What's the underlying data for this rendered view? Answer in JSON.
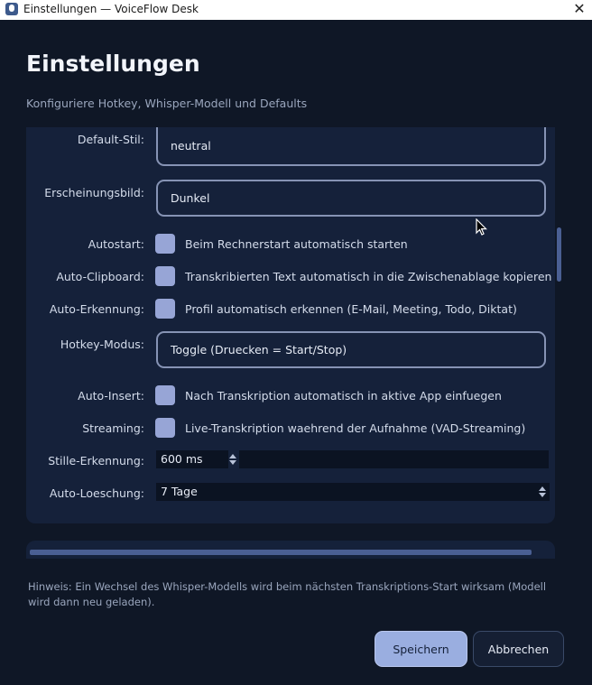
{
  "window": {
    "title": "Einstellungen — VoiceFlow Desk"
  },
  "page": {
    "title": "Einstellungen",
    "subtitle": "Konfiguriere Hotkey, Whisper-Modell und Defaults"
  },
  "settings": {
    "default_stil": {
      "label": "Default-Stil:",
      "value": "neutral"
    },
    "erscheinungsbild": {
      "label": "Erscheinungsbild:",
      "value": "Dunkel"
    },
    "autostart": {
      "label": "Autostart:",
      "text": "Beim Rechnerstart automatisch starten"
    },
    "auto_clipboard": {
      "label": "Auto-Clipboard:",
      "text": "Transkribierten Text automatisch in die Zwischenablage kopieren"
    },
    "auto_erkennung": {
      "label": "Auto-Erkennung:",
      "text": "Profil automatisch erkennen (E-Mail, Meeting, Todo, Diktat)"
    },
    "hotkey_modus": {
      "label": "Hotkey-Modus:",
      "value": "Toggle (Druecken = Start/Stop)"
    },
    "auto_insert": {
      "label": "Auto-Insert:",
      "text": "Nach Transkription automatisch in aktive App einfuegen"
    },
    "streaming": {
      "label": "Streaming:",
      "text": "Live-Transkription waehrend der Aufnahme (VAD-Streaming)"
    },
    "stille_erkennung": {
      "label": "Stille-Erkennung:",
      "value": "600 ms"
    },
    "auto_loeschung": {
      "label": "Auto-Loeschung:",
      "value": "7 Tage"
    }
  },
  "hint": "Hinweis: Ein Wechsel des Whisper-Modells wird beim nächsten Transkriptions-Start wirksam (Modell wird dann neu geladen).",
  "buttons": {
    "save": "Speichern",
    "cancel": "Abbrechen"
  },
  "icons": {
    "app": "microphone-icon",
    "close": "close-icon",
    "cursor": "mouse-pointer-icon"
  },
  "colors": {
    "background": "#0f1726",
    "panel": "#15213a",
    "accent": "#97a5d6",
    "primary_button": "#9aaee0"
  }
}
